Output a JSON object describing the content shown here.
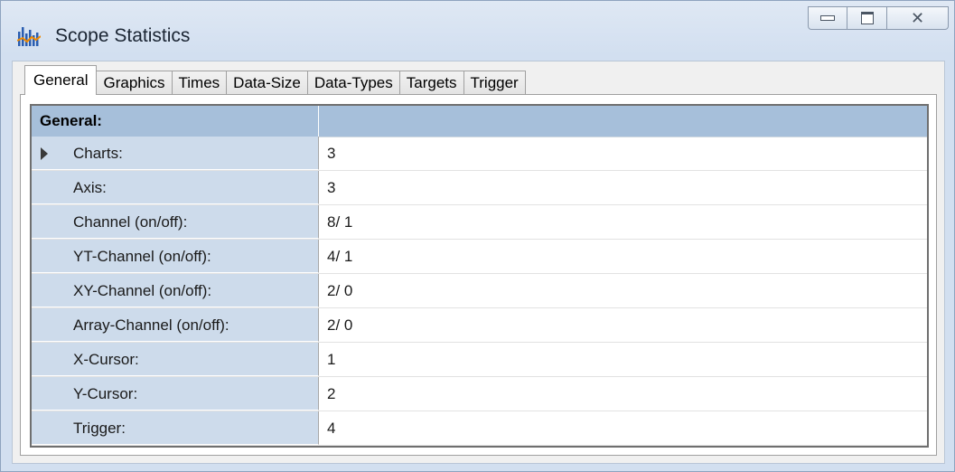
{
  "window": {
    "title": "Scope Statistics",
    "icon": "bar-chart-icon",
    "buttons": {
      "minimize": "minimize-icon",
      "maximize": "maximize-icon",
      "close": "close-icon"
    }
  },
  "tabs": [
    {
      "label": "General",
      "active": true
    },
    {
      "label": "Graphics",
      "active": false
    },
    {
      "label": "Times",
      "active": false
    },
    {
      "label": "Data-Size",
      "active": false
    },
    {
      "label": "Data-Types",
      "active": false
    },
    {
      "label": "Targets",
      "active": false
    },
    {
      "label": "Trigger",
      "active": false
    }
  ],
  "grid": {
    "header": "General:",
    "rows": [
      {
        "name": "Charts:",
        "value": "3",
        "selected": true
      },
      {
        "name": "Axis:",
        "value": "3"
      },
      {
        "name": "Channel (on/off):",
        "value": "8/ 1"
      },
      {
        "name": "YT-Channel (on/off):",
        "value": "4/ 1"
      },
      {
        "name": "XY-Channel (on/off):",
        "value": "2/ 0"
      },
      {
        "name": "Array-Channel (on/off):",
        "value": "2/ 0"
      },
      {
        "name": "X-Cursor:",
        "value": "1"
      },
      {
        "name": "Y-Cursor:",
        "value": "2"
      },
      {
        "name": "Trigger:",
        "value": "4"
      }
    ]
  },
  "colors": {
    "header_bg": "#a6bfda",
    "name_cell_bg": "#cddbeb",
    "icon_blue": "#2a5db0"
  }
}
